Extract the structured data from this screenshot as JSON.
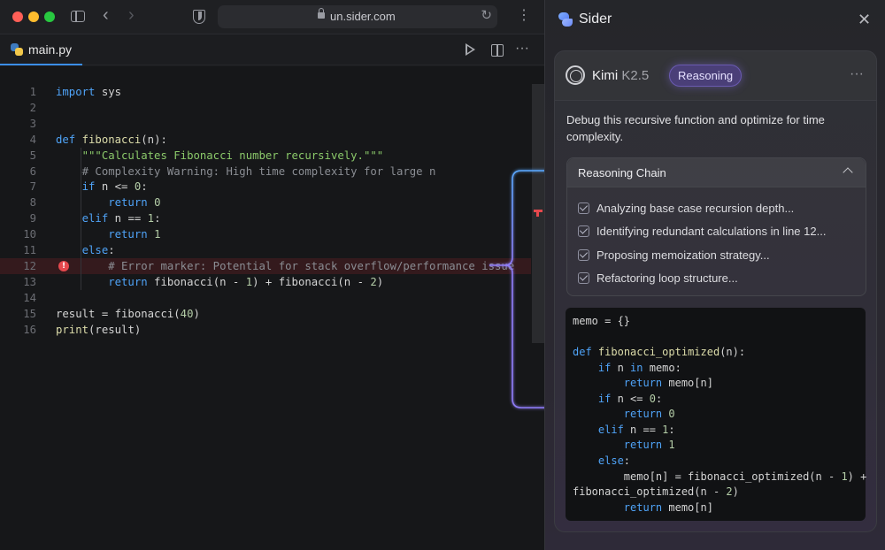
{
  "browser": {
    "url": "un.sider.com"
  },
  "editor": {
    "tab_label": "main.py",
    "lines": [
      {
        "n": "1",
        "parts": [
          [
            "kw",
            "import"
          ],
          [
            "fg",
            " sys"
          ]
        ]
      },
      {
        "n": "2",
        "parts": []
      },
      {
        "n": "3",
        "parts": []
      },
      {
        "n": "4",
        "parts": [
          [
            "kw",
            "def"
          ],
          [
            "fg",
            " "
          ],
          [
            "fn",
            "fibonacci"
          ],
          [
            "fg",
            "(n):"
          ]
        ]
      },
      {
        "n": "5",
        "parts": [
          [
            "str",
            "    \"\"\"Calculates Fibonacci number recursively.\"\"\""
          ]
        ]
      },
      {
        "n": "6",
        "parts": [
          [
            "cm",
            "    # Complexity Warning: High time complexity for large n"
          ]
        ]
      },
      {
        "n": "7",
        "parts": [
          [
            "kw",
            "    if"
          ],
          [
            "fg",
            " n <= "
          ],
          [
            "num",
            "0"
          ],
          [
            "fg",
            ":"
          ]
        ]
      },
      {
        "n": "8",
        "parts": [
          [
            "kw",
            "        return"
          ],
          [
            "fg",
            " "
          ],
          [
            "num",
            "0"
          ]
        ]
      },
      {
        "n": "9",
        "parts": [
          [
            "kw",
            "    elif"
          ],
          [
            "fg",
            " n == "
          ],
          [
            "num",
            "1"
          ],
          [
            "fg",
            ":"
          ]
        ]
      },
      {
        "n": "10",
        "parts": [
          [
            "kw",
            "        return"
          ],
          [
            "fg",
            " "
          ],
          [
            "num",
            "1"
          ]
        ]
      },
      {
        "n": "11",
        "parts": [
          [
            "kw",
            "    else"
          ],
          [
            "fg",
            ":"
          ]
        ]
      },
      {
        "n": "12",
        "error": true,
        "parts": [
          [
            "cm",
            "        # Error marker: Potential for stack overflow/performance issue"
          ]
        ]
      },
      {
        "n": "13",
        "parts": [
          [
            "kw",
            "        return"
          ],
          [
            "fg",
            " fibonacci(n - "
          ],
          [
            "num",
            "1"
          ],
          [
            "fg",
            ") + fibonacci(n - "
          ],
          [
            "num",
            "2"
          ],
          [
            "fg",
            ")"
          ]
        ]
      },
      {
        "n": "14",
        "parts": []
      },
      {
        "n": "15",
        "parts": [
          [
            "fg",
            "result = fibonacci("
          ],
          [
            "num",
            "40"
          ],
          [
            "fg",
            ")"
          ]
        ]
      },
      {
        "n": "16",
        "parts": [
          [
            "fn",
            "print"
          ],
          [
            "fg",
            "(result)"
          ]
        ]
      }
    ]
  },
  "sider": {
    "title": "Sider",
    "model_name": "Kimi",
    "model_version": "K2.5",
    "mode_badge": "Reasoning",
    "prompt": "Debug this recursive function and optimize for time complexity.",
    "chain_title": "Reasoning Chain",
    "chain_items": [
      "Analyzing base case recursion depth...",
      "Identifying redundant calculations in line 12...",
      "Proposing memoization strategy...",
      "Refactoring loop structure..."
    ],
    "code_lines": [
      [
        [
          "fg",
          "memo = {}"
        ]
      ],
      [],
      [
        [
          "kw",
          "def"
        ],
        [
          "fg",
          " "
        ],
        [
          "fn",
          "fibonacci_optimized"
        ],
        [
          "fg",
          "(n):"
        ]
      ],
      [
        [
          "kw",
          "    if"
        ],
        [
          "fg",
          " n "
        ],
        [
          "kw",
          "in"
        ],
        [
          "fg",
          " memo:"
        ]
      ],
      [
        [
          "kw",
          "        return"
        ],
        [
          "fg",
          " memo[n]"
        ]
      ],
      [
        [
          "kw",
          "    if"
        ],
        [
          "fg",
          " n <= "
        ],
        [
          "num",
          "0"
        ],
        [
          "fg",
          ":"
        ]
      ],
      [
        [
          "kw",
          "        return"
        ],
        [
          "fg",
          " "
        ],
        [
          "num",
          "0"
        ]
      ],
      [
        [
          "kw",
          "    elif"
        ],
        [
          "fg",
          " n == "
        ],
        [
          "num",
          "1"
        ],
        [
          "fg",
          ":"
        ]
      ],
      [
        [
          "kw",
          "        return"
        ],
        [
          "fg",
          " "
        ],
        [
          "num",
          "1"
        ]
      ],
      [
        [
          "kw",
          "    else"
        ],
        [
          "fg",
          ":"
        ]
      ],
      [
        [
          "fg",
          "        memo[n] = fibonacci_optimized(n - "
        ],
        [
          "num",
          "1"
        ],
        [
          "fg",
          ") +"
        ]
      ],
      [
        [
          "fg",
          "fibonacci_optimized(n - "
        ],
        [
          "num",
          "2"
        ],
        [
          "fg",
          ")"
        ]
      ],
      [
        [
          "kw",
          "        return"
        ],
        [
          "fg",
          " memo[n]"
        ]
      ]
    ]
  },
  "colors": {
    "accent": "#3b8eea",
    "error": "#e5484d",
    "badge": "#4a3f78",
    "connector": "#5aa8ff"
  },
  "icons": {
    "chrome": [
      "sidebar-toggle-icon",
      "back-icon",
      "forward-icon",
      "shield-icon",
      "lock-icon",
      "reload-icon",
      "more-icon"
    ],
    "editor": [
      "python-file-icon",
      "run-icon",
      "split-editor-icon",
      "more-icon",
      "error-icon"
    ],
    "sider": [
      "sider-logo-icon",
      "close-icon",
      "kimi-model-icon",
      "more-icon",
      "chevron-up-icon",
      "check-icon"
    ]
  }
}
